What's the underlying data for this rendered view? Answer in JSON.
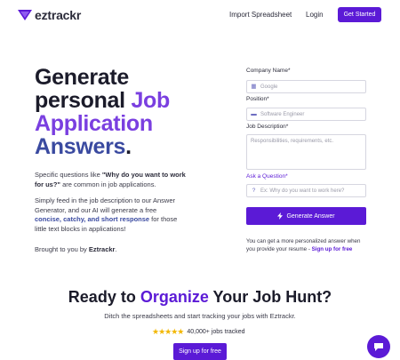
{
  "nav": {
    "logo_text": "eztrackr",
    "import_label": "Import Spreadsheet",
    "login_label": "Login",
    "get_started_label": "Get Started"
  },
  "hero": {
    "line1": "Generate",
    "line2a": "personal ",
    "line2b": "Job",
    "line3": "Application",
    "line4a": "Answers",
    "line4b": "."
  },
  "intro": {
    "p1a": "Specific questions like ",
    "p1b": "\"Why do you want to work for us?\"",
    "p1c": " are common in job applications.",
    "p2a": "Simply feed in the job description to our Answer Generator, and our AI will generate a free ",
    "p2b": "concise, catchy, and short response",
    "p2c": " for those little text blocks in applications!",
    "p3a": "Brought to you by ",
    "p3b": "Eztrackr",
    "p3c": "."
  },
  "form": {
    "company_label": "Company Name*",
    "company_placeholder": "Google",
    "position_label": "Position*",
    "position_placeholder": "Software Engineer",
    "jobdesc_label": "Job Description*",
    "jobdesc_placeholder": "Responsibilities, requirements, etc.",
    "ask_label": "Ask a Question*",
    "ask_placeholder": "Ex: Why do you want to work here?",
    "generate_label": "Generate Answer",
    "note_text": "You can get a more personalized answer when you provide your resume - ",
    "note_link": "Sign up for free"
  },
  "section": {
    "title_a": "Ready to ",
    "title_b": "Organize",
    "title_c": " Your Job Hunt?",
    "subtitle": "Ditch the spreadsheets and start tracking your jobs with Eztrackr.",
    "stars": "★★★★★",
    "tracked": "40,000+ jobs tracked",
    "signup_label": "Sign up for free"
  },
  "colors": {
    "accent": "#5b1ad6",
    "hero_purple": "#7a3fe0",
    "hero_blue": "#3a4aa0",
    "star": "#f2b705"
  },
  "icons": [
    "logo-icon",
    "building-icon",
    "briefcase-icon",
    "question-icon",
    "bolt-icon",
    "star-icon",
    "chat-icon"
  ]
}
